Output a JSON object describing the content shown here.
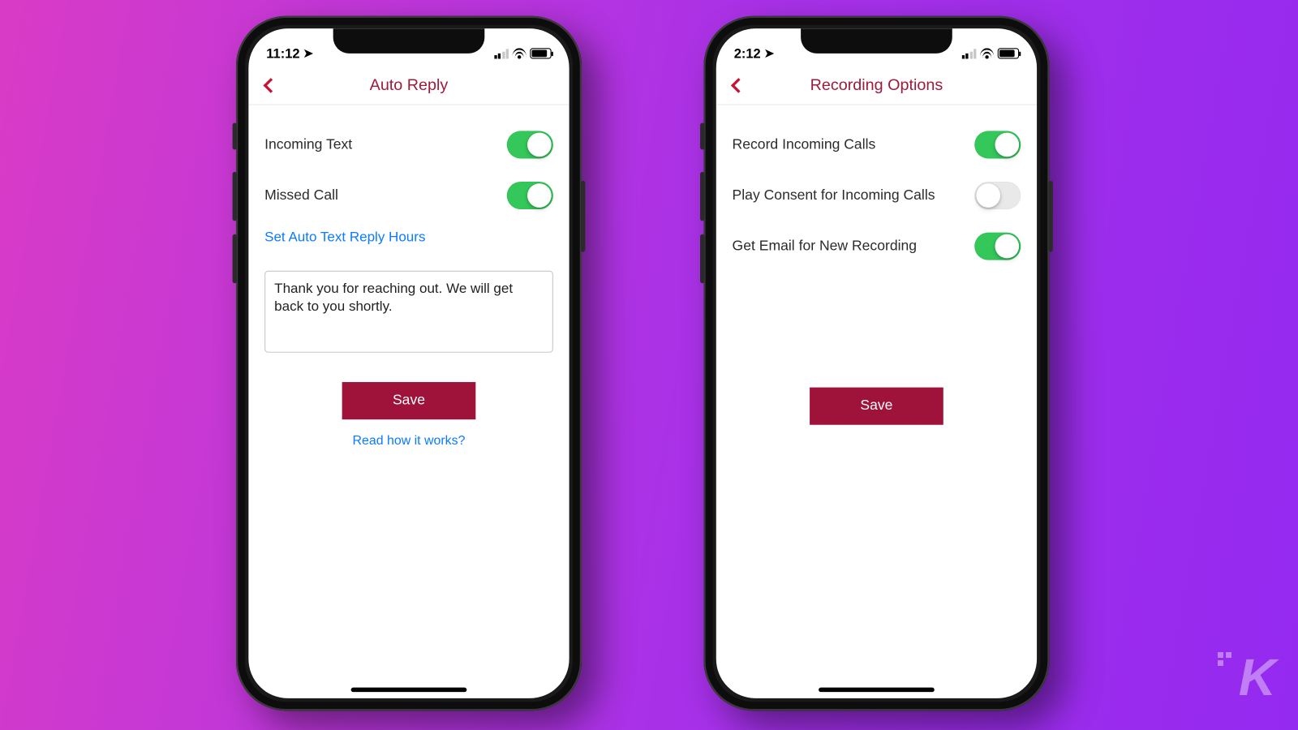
{
  "watermark": "K",
  "phones": {
    "auto_reply": {
      "status_time": "11:12",
      "title": "Auto Reply",
      "rows": [
        {
          "label": "Incoming Text",
          "on": true
        },
        {
          "label": "Missed Call",
          "on": true
        }
      ],
      "set_hours_link": "Set Auto Text Reply Hours",
      "message": "Thank you for reaching out. We will get back to you shortly.",
      "save_label": "Save",
      "help_link": "Read how it works?"
    },
    "recording": {
      "status_time": "2:12",
      "title": "Recording Options",
      "rows": [
        {
          "label": "Record Incoming Calls",
          "on": true
        },
        {
          "label": "Play Consent for Incoming Calls",
          "on": false
        },
        {
          "label": "Get Email for New Recording",
          "on": true
        }
      ],
      "save_label": "Save"
    }
  },
  "colors": {
    "accent": "#9f1239",
    "link": "#0b7bff",
    "toggle_on": "#34c759"
  }
}
